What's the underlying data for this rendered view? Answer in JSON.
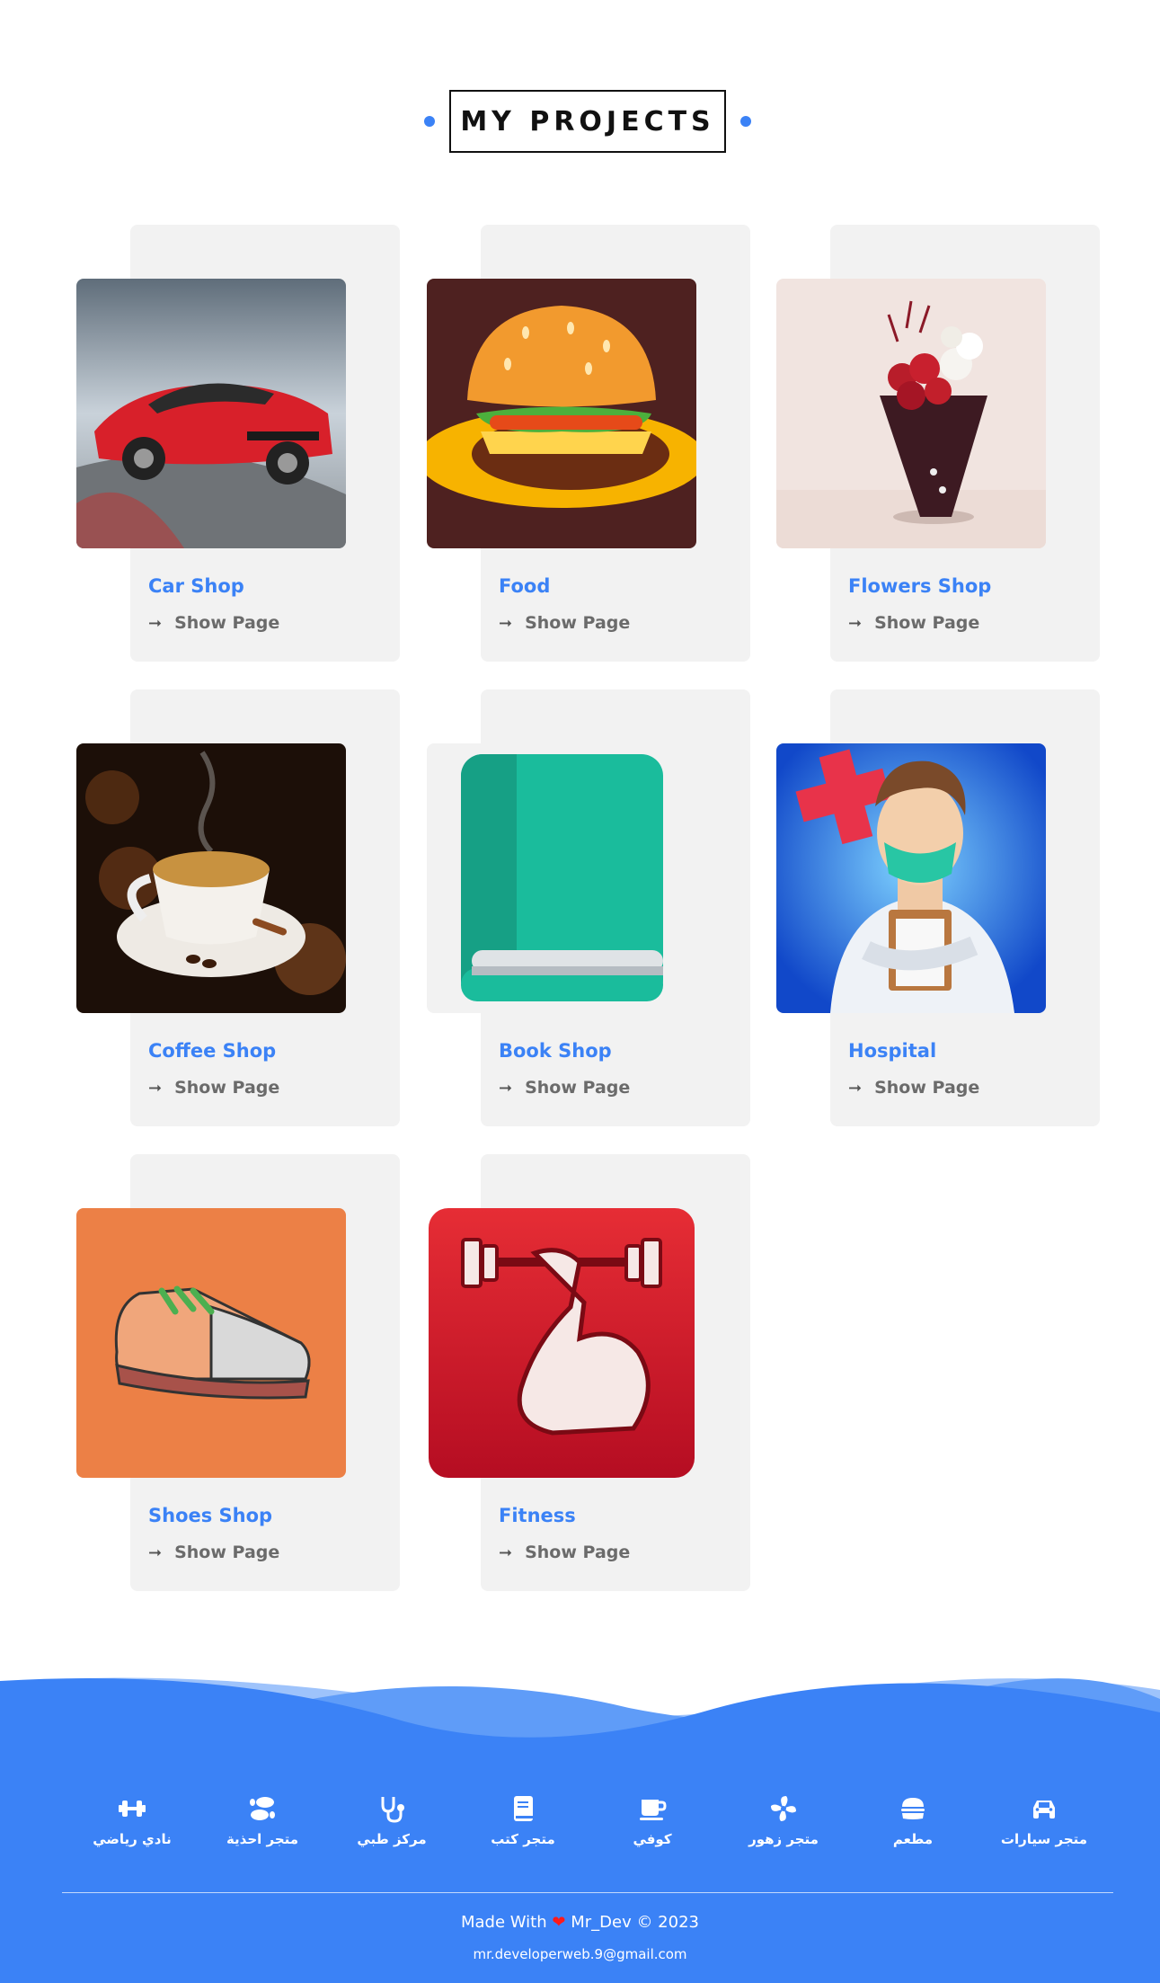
{
  "header": {
    "title": "MY PROJECTS"
  },
  "projects": [
    {
      "title": "Car Shop",
      "link_label": "Show Page",
      "image": "red-sports-car"
    },
    {
      "title": "Food",
      "link_label": "Show Page",
      "image": "burger"
    },
    {
      "title": "Flowers Shop",
      "link_label": "Show Page",
      "image": "rose-bouquet"
    },
    {
      "title": "Coffee Shop",
      "link_label": "Show Page",
      "image": "coffee-cup"
    },
    {
      "title": "Book Shop",
      "link_label": "Show Page",
      "image": "green-book"
    },
    {
      "title": "Hospital",
      "link_label": "Show Page",
      "image": "doctor"
    },
    {
      "title": "Shoes Shop",
      "link_label": "Show Page",
      "image": "sneaker"
    },
    {
      "title": "Fitness",
      "link_label": "Show Page",
      "image": "flexed-arm-dumbbell"
    }
  ],
  "footer": {
    "links": [
      {
        "label": "متجر سيارات",
        "icon": "car-icon"
      },
      {
        "label": "مطعم",
        "icon": "burger-icon"
      },
      {
        "label": "متجر زهور",
        "icon": "flower-icon"
      },
      {
        "label": "كوفي",
        "icon": "mug-icon"
      },
      {
        "label": "متجر كتب",
        "icon": "book-icon"
      },
      {
        "label": "مركز طبي",
        "icon": "stethoscope-icon"
      },
      {
        "label": "متجر احذية",
        "icon": "shoe-prints-icon"
      },
      {
        "label": "نادي رياضي",
        "icon": "dumbbell-icon"
      }
    ],
    "made_with_prefix": "Made With",
    "made_with_suffix": "Mr_Dev © 2023",
    "email": "mr.developerweb.9@gmail.com"
  },
  "colors": {
    "accent": "#3b82f6",
    "card_bg": "#f2f2f2",
    "footer_bg": "#3b82f6",
    "link_gray": "#6b6b6b"
  }
}
